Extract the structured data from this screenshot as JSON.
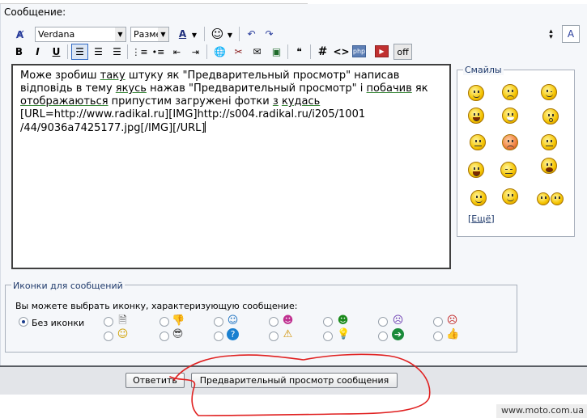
{
  "form": {
    "message_label": "Сообщение:"
  },
  "toolbar": {
    "font_name": "Verdana",
    "font_size": "Разме",
    "buttons_row1": [
      "remove-format-icon",
      "font-color-icon",
      "smiley-icon",
      "undo-icon",
      "redo-icon"
    ],
    "buttons_row2": [
      "bold",
      "italic",
      "underline",
      "align-left",
      "align-center",
      "align-right",
      "ordered-list",
      "unordered-list",
      "outdent",
      "indent",
      "link",
      "unlink",
      "email",
      "image",
      "quote",
      "hash",
      "code",
      "php",
      "youtube",
      "off"
    ],
    "bold": "B",
    "italic": "I",
    "underline": "U",
    "hash": "#",
    "code": "<>",
    "off": "off"
  },
  "editor": {
    "line1_a": "Може зробиш ",
    "line1_u1": "таку",
    "line1_b": " штуку як \"Предварительный просмотр\" написав",
    "line2_a": "відповідь в тему ",
    "line2_u1": "якусь",
    "line2_b": " нажав \"Предварительный просмотр\" і ",
    "line2_u2": "побачив",
    "line2_c": " як",
    "line3_u1": "отображаються",
    "line3_a": " припустим загружені фотки ",
    "line3_u2": "з",
    "line3_b": " ",
    "line3_u3": "кудась",
    "line4": "[URL=http://www.radikal.ru][IMG]http://s004.radikal.ru/i205/1001",
    "line5": "/44/9036a7425177.jpg[/IMG][/URL]"
  },
  "smilies": {
    "title": "Смайлы",
    "more_link": "Ещё",
    "more_prefix": "[",
    "more_suffix": "]"
  },
  "message_icons": {
    "title": "Иконки для сообщений",
    "description": "Вы можете выбрать иконку, характеризующую сообщение:",
    "no_icon_label": "Без иконки",
    "selected": "no-icon",
    "icons_top": [
      "document-icon",
      "thumbs-down-icon",
      "smile-icon",
      "grin-icon",
      "big-grin-icon",
      "sad-purple-icon",
      "angry-icon"
    ],
    "icons_bottom": [
      "smile-yellow-icon",
      "cool-icon",
      "question-icon",
      "warning-icon",
      "lightbulb-icon",
      "arrow-right-icon",
      "thumbs-up-icon"
    ]
  },
  "actions": {
    "reply_button": "Ответить",
    "preview_button": "Предварительный просмотр сообщения"
  },
  "watermark": "www.moto.com.ua",
  "colors": {
    "accent": "#316ac5",
    "annotation": "#e02020",
    "panel_bg": "#f5f7fa"
  }
}
